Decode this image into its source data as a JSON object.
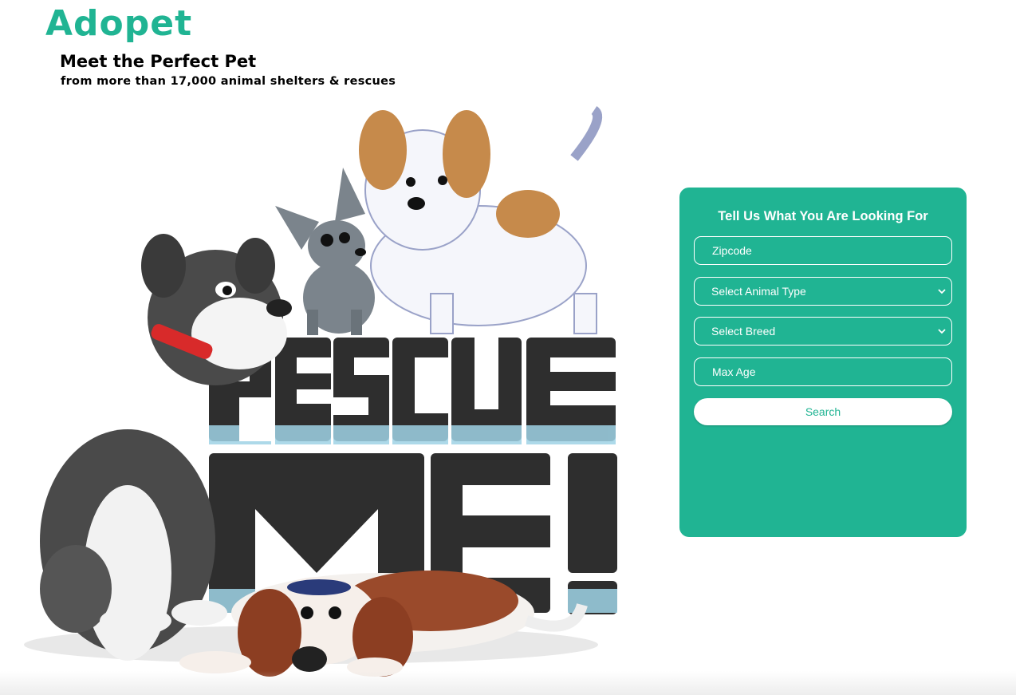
{
  "header": {
    "logo": "Adopet",
    "tagline": "Meet the Perfect Pet",
    "subtagline": "from more than 17,000 animal shelters & rescues"
  },
  "hero": {
    "image_text_line1": "RESCUE",
    "image_text_line2": "ME!"
  },
  "search_panel": {
    "title": "Tell Us What You Are Looking For",
    "zipcode_placeholder": "Zipcode",
    "animal_type_selected": "Select Animal Type",
    "breed_selected": "Select Breed",
    "max_age_placeholder": "Max Age",
    "search_label": "Search"
  },
  "colors": {
    "brand": "#20b493",
    "text": "#000000",
    "panel_text": "#ffffff"
  }
}
